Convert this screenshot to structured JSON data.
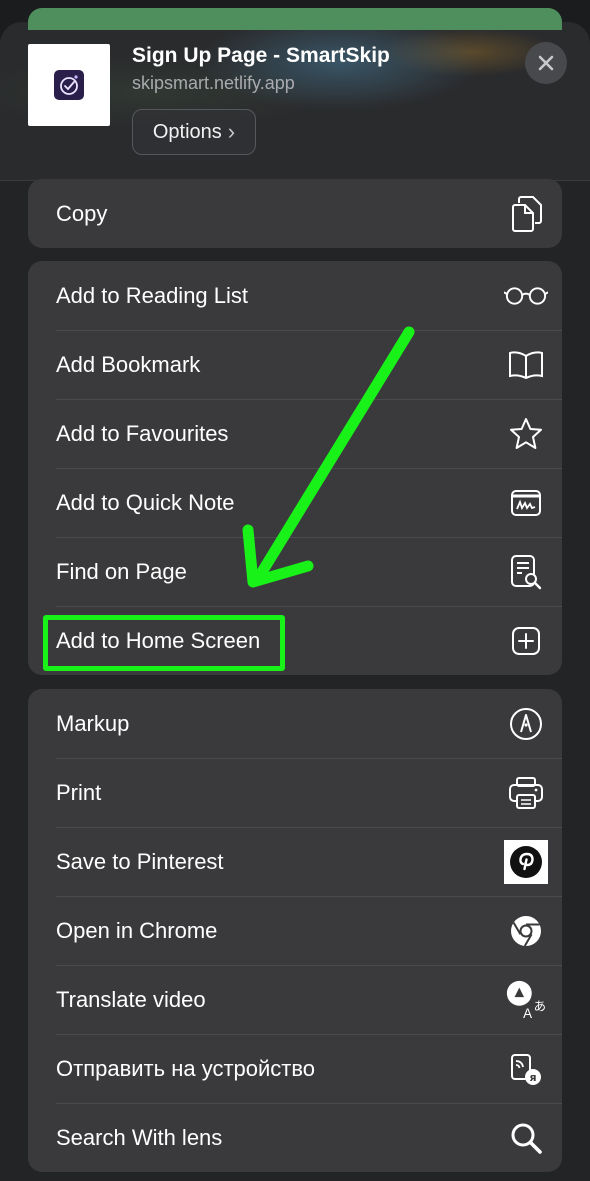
{
  "header": {
    "title": "Sign Up Page - SmartSkip",
    "url": "skipsmart.netlify.app",
    "options_label": "Options",
    "options_chevron": "›"
  },
  "copy_group": [
    {
      "label": "Copy",
      "icon": "copy-icon"
    }
  ],
  "main_group": [
    {
      "label": "Add to Reading List",
      "icon": "glasses-icon"
    },
    {
      "label": "Add Bookmark",
      "icon": "book-icon"
    },
    {
      "label": "Add to Favourites",
      "icon": "star-icon"
    },
    {
      "label": "Add to Quick Note",
      "icon": "quick-note-icon"
    },
    {
      "label": "Find on Page",
      "icon": "find-on-page-icon"
    },
    {
      "label": "Add to Home Screen",
      "icon": "add-square-icon"
    }
  ],
  "extensions_group": [
    {
      "label": "Markup",
      "icon": "markup-pen-icon"
    },
    {
      "label": "Print",
      "icon": "printer-icon"
    },
    {
      "label": "Save to Pinterest",
      "icon": "pinterest-icon"
    },
    {
      "label": "Open in Chrome",
      "icon": "chrome-icon"
    },
    {
      "label": "Translate video",
      "icon": "translate-icon"
    },
    {
      "label": "Отправить на устройство",
      "icon": "send-to-device-icon"
    },
    {
      "label": "Search With lens",
      "icon": "search-icon"
    }
  ],
  "colors": {
    "annotation": "#19f219",
    "row_background": "#3a3a3c",
    "sheet_background": "#232426"
  }
}
